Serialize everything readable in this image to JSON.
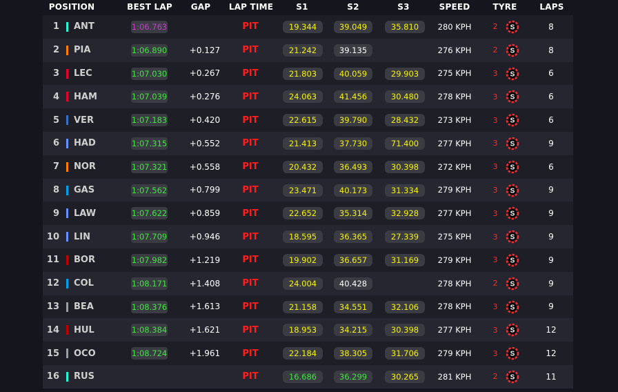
{
  "colors": {
    "background": "#15151e",
    "row_odd": "#1e1e27",
    "row_even": "#262630",
    "pill_bg": "#3b3b44",
    "purple": "#c53fc9",
    "green": "#3ce93c",
    "yellow": "#f4f400",
    "pit_red": "#ff1e1e",
    "tyre_red": "#ff2a2a",
    "white": "#ffffff"
  },
  "header": {
    "position": "POSITION",
    "best_lap": "BEST LAP",
    "gap": "GAP",
    "lap_time": "LAP TIME",
    "s1": "S1",
    "s2": "S2",
    "s3": "S3",
    "speed": "SPEED",
    "tyre": "TYRE",
    "laps": "LAPS"
  },
  "rows": [
    {
      "pos": "1",
      "driver": "ANT",
      "team_color": "#27f4d2",
      "best_lap": "1:06.763",
      "best_color": "purple",
      "gap": "",
      "lap_time": "PIT",
      "s1": "19.344",
      "s1_color": "yellow",
      "s2": "39.049",
      "s2_color": "yellow",
      "s3": "35.810",
      "s3_color": "yellow",
      "speed": "280 KPH",
      "tyre_age": "2",
      "tyre": "soft-tyre-icon",
      "tyre_letter": "S",
      "laps": "8"
    },
    {
      "pos": "2",
      "driver": "PIA",
      "team_color": "#ff8000",
      "best_lap": "1:06.890",
      "best_color": "green",
      "gap": "+0.127",
      "lap_time": "PIT",
      "s1": "21.242",
      "s1_color": "yellow",
      "s2": "39.135",
      "s2_color": "white",
      "s3": "",
      "s3_color": "white",
      "speed": "276 KPH",
      "tyre_age": "2",
      "tyre": "soft-tyre-icon",
      "tyre_letter": "S",
      "laps": "8"
    },
    {
      "pos": "3",
      "driver": "LEC",
      "team_color": "#e8002d",
      "best_lap": "1:07.030",
      "best_color": "green",
      "gap": "+0.267",
      "lap_time": "PIT",
      "s1": "21.803",
      "s1_color": "yellow",
      "s2": "40.059",
      "s2_color": "yellow",
      "s3": "29.903",
      "s3_color": "yellow",
      "speed": "275 KPH",
      "tyre_age": "3",
      "tyre": "soft-tyre-icon",
      "tyre_letter": "S",
      "laps": "6"
    },
    {
      "pos": "4",
      "driver": "HAM",
      "team_color": "#e8002d",
      "best_lap": "1:07.039",
      "best_color": "green",
      "gap": "+0.276",
      "lap_time": "PIT",
      "s1": "24.063",
      "s1_color": "yellow",
      "s2": "41.456",
      "s2_color": "yellow",
      "s3": "30.480",
      "s3_color": "yellow",
      "speed": "278 KPH",
      "tyre_age": "3",
      "tyre": "soft-tyre-icon",
      "tyre_letter": "S",
      "laps": "6"
    },
    {
      "pos": "5",
      "driver": "VER",
      "team_color": "#3671c6",
      "best_lap": "1:07.183",
      "best_color": "green",
      "gap": "+0.420",
      "lap_time": "PIT",
      "s1": "22.615",
      "s1_color": "yellow",
      "s2": "39.790",
      "s2_color": "yellow",
      "s3": "28.432",
      "s3_color": "yellow",
      "speed": "273 KPH",
      "tyre_age": "3",
      "tyre": "soft-tyre-icon",
      "tyre_letter": "S",
      "laps": "6"
    },
    {
      "pos": "6",
      "driver": "HAD",
      "team_color": "#6692ff",
      "best_lap": "1:07.315",
      "best_color": "green",
      "gap": "+0.552",
      "lap_time": "PIT",
      "s1": "21.413",
      "s1_color": "yellow",
      "s2": "37.730",
      "s2_color": "yellow",
      "s3": "71.400",
      "s3_color": "yellow",
      "speed": "277 KPH",
      "tyre_age": "3",
      "tyre": "soft-tyre-icon",
      "tyre_letter": "S",
      "laps": "9"
    },
    {
      "pos": "7",
      "driver": "NOR",
      "team_color": "#ff8000",
      "best_lap": "1:07.321",
      "best_color": "green",
      "gap": "+0.558",
      "lap_time": "PIT",
      "s1": "20.432",
      "s1_color": "yellow",
      "s2": "36.493",
      "s2_color": "yellow",
      "s3": "30.398",
      "s3_color": "yellow",
      "speed": "272 KPH",
      "tyre_age": "3",
      "tyre": "soft-tyre-icon",
      "tyre_letter": "S",
      "laps": "6"
    },
    {
      "pos": "8",
      "driver": "GAS",
      "team_color": "#00a1e8",
      "best_lap": "1:07.562",
      "best_color": "green",
      "gap": "+0.799",
      "lap_time": "PIT",
      "s1": "23.471",
      "s1_color": "yellow",
      "s2": "40.173",
      "s2_color": "yellow",
      "s3": "31.334",
      "s3_color": "yellow",
      "speed": "279 KPH",
      "tyre_age": "3",
      "tyre": "soft-tyre-icon",
      "tyre_letter": "S",
      "laps": "9"
    },
    {
      "pos": "9",
      "driver": "LAW",
      "team_color": "#6692ff",
      "best_lap": "1:07.622",
      "best_color": "green",
      "gap": "+0.859",
      "lap_time": "PIT",
      "s1": "22.652",
      "s1_color": "yellow",
      "s2": "35.314",
      "s2_color": "yellow",
      "s3": "32.928",
      "s3_color": "yellow",
      "speed": "277 KPH",
      "tyre_age": "3",
      "tyre": "soft-tyre-icon",
      "tyre_letter": "S",
      "laps": "9"
    },
    {
      "pos": "10",
      "driver": "LIN",
      "team_color": "#6692ff",
      "best_lap": "1:07.709",
      "best_color": "green",
      "gap": "+0.946",
      "lap_time": "PIT",
      "s1": "18.595",
      "s1_color": "yellow",
      "s2": "36.365",
      "s2_color": "yellow",
      "s3": "27.339",
      "s3_color": "yellow",
      "speed": "275 KPH",
      "tyre_age": "3",
      "tyre": "soft-tyre-icon",
      "tyre_letter": "S",
      "laps": "9"
    },
    {
      "pos": "11",
      "driver": "BOR",
      "team_color": "#c00000",
      "best_lap": "1:07.982",
      "best_color": "green",
      "gap": "+1.219",
      "lap_time": "PIT",
      "s1": "19.902",
      "s1_color": "yellow",
      "s2": "36.657",
      "s2_color": "yellow",
      "s3": "31.169",
      "s3_color": "yellow",
      "speed": "279 KPH",
      "tyre_age": "3",
      "tyre": "soft-tyre-icon",
      "tyre_letter": "S",
      "laps": "9"
    },
    {
      "pos": "12",
      "driver": "COL",
      "team_color": "#00a1e8",
      "best_lap": "1:08.171",
      "best_color": "green",
      "gap": "+1.408",
      "lap_time": "PIT",
      "s1": "24.004",
      "s1_color": "yellow",
      "s2": "40.428",
      "s2_color": "white",
      "s3": "",
      "s3_color": "white",
      "speed": "278 KPH",
      "tyre_age": "2",
      "tyre": "soft-tyre-icon",
      "tyre_letter": "S",
      "laps": "9"
    },
    {
      "pos": "13",
      "driver": "BEA",
      "team_color": "#9c9fa2",
      "best_lap": "1:08.376",
      "best_color": "green",
      "gap": "+1.613",
      "lap_time": "PIT",
      "s1": "21.158",
      "s1_color": "yellow",
      "s2": "34.551",
      "s2_color": "yellow",
      "s3": "32.106",
      "s3_color": "yellow",
      "speed": "278 KPH",
      "tyre_age": "3",
      "tyre": "soft-tyre-icon",
      "tyre_letter": "S",
      "laps": "9"
    },
    {
      "pos": "14",
      "driver": "HUL",
      "team_color": "#c00000",
      "best_lap": "1:08.384",
      "best_color": "green",
      "gap": "+1.621",
      "lap_time": "PIT",
      "s1": "18.953",
      "s1_color": "yellow",
      "s2": "34.215",
      "s2_color": "yellow",
      "s3": "30.398",
      "s3_color": "yellow",
      "speed": "277 KPH",
      "tyre_age": "3",
      "tyre": "soft-tyre-icon",
      "tyre_letter": "S",
      "laps": "12"
    },
    {
      "pos": "15",
      "driver": "OCO",
      "team_color": "#9c9fa2",
      "best_lap": "1:08.724",
      "best_color": "green",
      "gap": "+1.961",
      "lap_time": "PIT",
      "s1": "22.184",
      "s1_color": "yellow",
      "s2": "38.305",
      "s2_color": "yellow",
      "s3": "31.706",
      "s3_color": "yellow",
      "speed": "279 KPH",
      "tyre_age": "3",
      "tyre": "soft-tyre-icon",
      "tyre_letter": "S",
      "laps": "12"
    },
    {
      "pos": "16",
      "driver": "RUS",
      "team_color": "#27f4d2",
      "best_lap": "",
      "best_color": "green",
      "gap": "",
      "lap_time": "PIT",
      "s1": "16.686",
      "s1_color": "green",
      "s2": "36.299",
      "s2_color": "green",
      "s3": "30.265",
      "s3_color": "yellow",
      "speed": "281 KPH",
      "tyre_age": "2",
      "tyre": "soft-tyre-icon",
      "tyre_letter": "S",
      "laps": "11"
    }
  ]
}
